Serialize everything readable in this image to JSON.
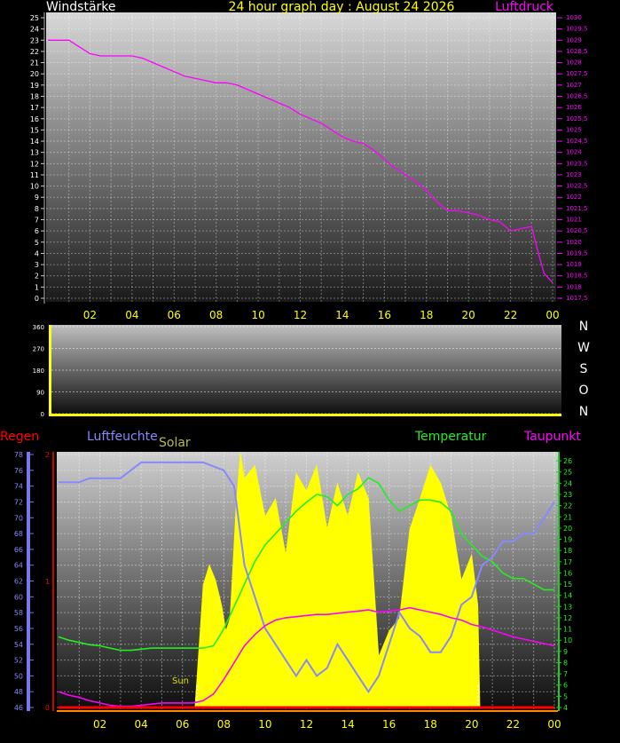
{
  "title": "24 hour graph day : August 24 2026",
  "time_ticks": [
    "02",
    "04",
    "06",
    "08",
    "10",
    "12",
    "14",
    "16",
    "18",
    "20",
    "22",
    "00"
  ],
  "colors": {
    "pressure": "#ff00ff",
    "temperature": "#22ee22",
    "humidity": "#8888ff",
    "dewpoint": "#ff00ff",
    "rain": "#ff0000",
    "solar": "#ffff00",
    "wind": "#ffffff"
  },
  "chart_data": [
    {
      "id": "wind-pressure",
      "type": "line",
      "left_label": "Windstärke",
      "right_label": "Luftdruck",
      "x_hours": [
        0,
        0.5,
        1,
        1.5,
        2,
        2.5,
        3,
        3.5,
        4,
        4.5,
        5,
        5.5,
        6,
        6.5,
        7,
        7.5,
        8,
        8.5,
        9,
        9.5,
        10,
        10.5,
        11,
        11.5,
        12,
        12.5,
        13,
        13.5,
        14,
        14.5,
        15,
        15.5,
        16,
        16.5,
        17,
        17.5,
        18,
        18.5,
        19,
        19.5,
        20,
        20.5,
        21,
        21.5,
        22,
        22.5,
        23,
        23.3,
        23.6,
        24
      ],
      "series": [
        {
          "name": "Luftdruck",
          "axis": "right",
          "color": "#ff00ff",
          "values": [
            1029,
            1029,
            1029,
            1028.7,
            1028.4,
            1028.3,
            1028.3,
            1028.3,
            1028.3,
            1028.2,
            1028,
            1027.8,
            1027.6,
            1027.4,
            1027.3,
            1027.2,
            1027.1,
            1027.1,
            1027,
            1026.8,
            1026.6,
            1026.4,
            1026.2,
            1026,
            1025.7,
            1025.5,
            1025.3,
            1025,
            1024.7,
            1024.5,
            1024.4,
            1024.1,
            1023.7,
            1023.3,
            1023,
            1022.7,
            1022.3,
            1021.8,
            1021.4,
            1021.4,
            1021.3,
            1021.2,
            1021,
            1020.9,
            1020.5,
            1020.6,
            1020.7,
            1019.6,
            1018.6,
            1018.2
          ]
        }
      ],
      "ylim_left": [
        0,
        25
      ],
      "ylim_right": [
        1017.5,
        1030
      ],
      "left_ticks": [
        "0",
        "1",
        "2",
        "3",
        "4",
        "5",
        "6",
        "7",
        "8",
        "9",
        "10",
        "11",
        "12",
        "13",
        "14",
        "15",
        "16",
        "17",
        "18",
        "19",
        "20",
        "21",
        "22",
        "23",
        "24",
        "25"
      ],
      "right_ticks": [
        "1017,5",
        "1018",
        "1018,5",
        "1019",
        "1019,5",
        "1020",
        "1020,5",
        "1021",
        "1021,5",
        "1022",
        "1022,5",
        "1023",
        "1023,5",
        "1024",
        "1024,5",
        "1025",
        "1025,5",
        "1026",
        "1026,5",
        "1027",
        "1027,5",
        "1028",
        "1028,5",
        "1029",
        "1029,5",
        "1030"
      ]
    },
    {
      "id": "wind-direction",
      "type": "line",
      "left_ticks": [
        "0",
        "90",
        "180",
        "270",
        "360"
      ],
      "ylim": [
        0,
        360
      ],
      "direction_labels": [
        "N",
        "W",
        "S",
        "O",
        "N"
      ],
      "series": [
        {
          "name": "direction",
          "values": [
            0
          ]
        }
      ]
    },
    {
      "id": "weather",
      "type": "line",
      "labels": {
        "rain": "Regen",
        "humidity": "Luftfeuchte",
        "solar": "Solar",
        "temperature": "Temperatur",
        "dewpoint": "Taupunkt",
        "sun": "Sun"
      },
      "humidity_ticks": [
        "46",
        "48",
        "50",
        "52",
        "54",
        "56",
        "58",
        "60",
        "62",
        "64",
        "66",
        "68",
        "70",
        "72",
        "74",
        "76",
        "78"
      ],
      "temp_ticks": [
        "4",
        "5",
        "6",
        "7",
        "8",
        "9",
        "10",
        "11",
        "12",
        "13",
        "14",
        "15",
        "16",
        "17",
        "18",
        "19",
        "20",
        "21",
        "22",
        "23",
        "24",
        "25",
        "26"
      ],
      "rain_ticks": [
        "0",
        "1",
        "2"
      ],
      "ylim_humidity": [
        46,
        78
      ],
      "ylim_temp": [
        4,
        26.8
      ],
      "sun_start_hour": 6.7,
      "sun_end_hour": 20.3,
      "temperature": {
        "x": [
          0,
          0.5,
          1,
          1.5,
          2,
          2.5,
          3,
          3.5,
          4,
          4.5,
          5,
          5.5,
          6,
          6.5,
          7,
          7.5,
          8,
          8.5,
          9,
          9.5,
          10,
          10.5,
          11,
          11.5,
          12,
          12.5,
          13,
          13.5,
          14,
          14.5,
          15,
          15.5,
          16,
          16.5,
          17,
          17.5,
          18,
          18.5,
          19,
          19.5,
          20,
          20.5,
          21,
          21.5,
          22,
          22.5,
          23,
          23.5,
          24
        ],
        "values": [
          10.3,
          10,
          9.8,
          9.6,
          9.5,
          9.3,
          9.1,
          9.1,
          9.2,
          9.3,
          9.3,
          9.3,
          9.3,
          9.3,
          9.3,
          9.5,
          11,
          13,
          15,
          17,
          18.5,
          19.5,
          20.5,
          21.5,
          22.3,
          23,
          22.8,
          22,
          23,
          23.5,
          24.5,
          24,
          22.5,
          21.5,
          22,
          22.5,
          22.5,
          22.3,
          21.5,
          19.5,
          18.5,
          17.5,
          17,
          16,
          15.5,
          15.5,
          15,
          14.5,
          14.5
        ]
      },
      "dewpoint": {
        "x": [
          0,
          0.5,
          1,
          1.5,
          2,
          2.5,
          3,
          3.5,
          4,
          4.5,
          5,
          5.5,
          6,
          6.5,
          7,
          7.5,
          8,
          8.5,
          9,
          9.5,
          10,
          10.5,
          11,
          11.5,
          12,
          12.5,
          13,
          13.5,
          14,
          14.5,
          15,
          15.5,
          16,
          16.5,
          17,
          17.5,
          18,
          18.5,
          19,
          19.5,
          20,
          20.5,
          21,
          21.5,
          22,
          22.5,
          23,
          23.5,
          24
        ],
        "values": [
          5.4,
          5.1,
          4.9,
          4.6,
          4.4,
          4.2,
          4.1,
          4.1,
          4.2,
          4.3,
          4.4,
          4.4,
          4.4,
          4.4,
          4.6,
          5.2,
          6.5,
          8,
          9.5,
          10.5,
          11.3,
          11.8,
          12,
          12.1,
          12.2,
          12.3,
          12.3,
          12.4,
          12.5,
          12.6,
          12.7,
          12.5,
          12.6,
          12.7,
          12.9,
          12.7,
          12.5,
          12.3,
          12,
          11.8,
          11.4,
          11.2,
          10.9,
          10.6,
          10.3,
          10.1,
          9.9,
          9.7,
          9.5
        ]
      },
      "humidity": {
        "x": [
          0,
          1,
          1.5,
          2,
          3,
          3.5,
          4,
          5,
          6,
          7,
          8,
          8.5,
          9,
          9.5,
          10,
          10.5,
          11,
          11.5,
          12,
          12.5,
          13,
          13.5,
          14,
          14.5,
          15,
          15.5,
          16,
          16.5,
          17,
          17.5,
          18,
          18.5,
          19,
          19.5,
          20,
          20.5,
          21,
          21.5,
          22,
          22.5,
          23,
          23.5,
          24
        ],
        "values": [
          74.5,
          74.5,
          75,
          75,
          75,
          76,
          77,
          77,
          77,
          77,
          76,
          74,
          64,
          60,
          56,
          54,
          52,
          50,
          52,
          50,
          51,
          54,
          52,
          50,
          48,
          50,
          54,
          58,
          56,
          55,
          53,
          53,
          55,
          59,
          60,
          64,
          65,
          67,
          67,
          68,
          68,
          70,
          72
        ]
      },
      "solar": {
        "x": [
          0,
          6.6,
          6.7,
          7,
          7.3,
          7.6,
          7.9,
          8.1,
          8.3,
          8.6,
          8.8,
          9,
          9.5,
          10,
          10.5,
          11,
          11.5,
          12,
          12.5,
          13,
          13.5,
          14,
          14.5,
          15,
          15.5,
          16,
          16.5,
          17,
          17.5,
          18,
          18.5,
          19,
          19.5,
          20,
          20.3,
          20.4,
          24
        ],
        "values": [
          0,
          0,
          12,
          48,
          56,
          50,
          40,
          30,
          35,
          80,
          100,
          90,
          95,
          75,
          82,
          60,
          92,
          85,
          95,
          70,
          88,
          75,
          92,
          82,
          20,
          30,
          35,
          70,
          82,
          95,
          88,
          75,
          50,
          60,
          40,
          0,
          0
        ]
      },
      "rain": {
        "x": [
          0,
          24
        ],
        "values": [
          0,
          0
        ]
      }
    }
  ]
}
